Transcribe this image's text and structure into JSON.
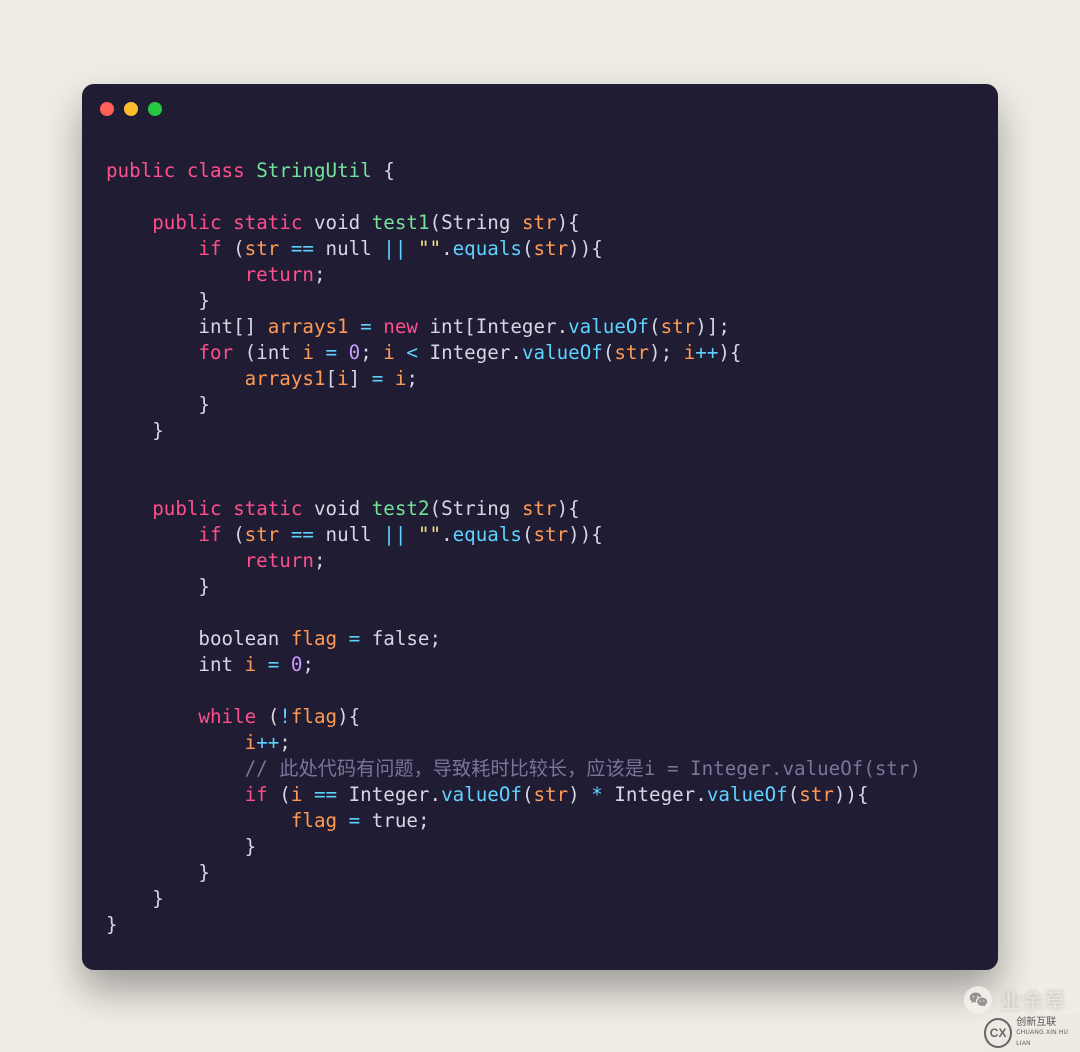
{
  "window": {
    "dot_colors": [
      "#ff5f57",
      "#febc2e",
      "#28c840"
    ]
  },
  "code": {
    "class_decl": {
      "kw_public": "public",
      "kw_class": "class",
      "name": "StringUtil",
      "brace_open": " {"
    },
    "m1": {
      "kw_public": "public",
      "kw_static": "static",
      "ret": "void",
      "name": "test1",
      "param_type": "String",
      "param_name": "str",
      "tail": "){",
      "if_kw": "if",
      "if_open": " (",
      "var_str": "str",
      "op_eq": " == ",
      "null_lit": "null",
      "op_or": " || ",
      "str_lit": "\"\"",
      "dot": ".",
      "equals_call": "equals",
      "p_open": "(",
      "arg_str": "str",
      "p_close_brace": ")){",
      "return_kw": "return",
      "semi": ";",
      "brace_close": "}",
      "intarr": "int[] ",
      "arrays1": "arrays1",
      "op_assign": " = ",
      "new_kw": "new",
      "int_bracket_open": " int[",
      "Integer": "Integer",
      "dot2": ".",
      "valueOf": "valueOf",
      "p_open2": "(",
      "arg_str2": "str",
      "p_close2_bracket_semi": ")];",
      "for_kw": "for",
      "for_open": " (",
      "for_int": "int ",
      "i": "i",
      "assign0": " = ",
      "zero": "0",
      "semi1": "; ",
      "i2": "i",
      "lt": " < ",
      "Integer2": "Integer",
      "dot3": ".",
      "valueOf2": "valueOf",
      "p_open3": "(",
      "arg_str3": "str",
      "p_close3_semi": "); ",
      "i3": "i",
      "pp": "++",
      "for_tail": "){",
      "arr_idx_open": "arrays1",
      "idx_open": "[",
      "i4": "i",
      "idx_close": "] ",
      "assign_i": "= ",
      "i5": "i",
      "semi2": ";",
      "brace_close2": "}",
      "brace_close3": "}"
    },
    "m2": {
      "kw_public": "public",
      "kw_static": "static",
      "ret": "void",
      "name": "test2",
      "param_type": "String",
      "param_name": "str",
      "tail": "){",
      "if_kw": "if",
      "if_open": " (",
      "var_str": "str",
      "op_eq": " == ",
      "null_lit": "null",
      "op_or": " || ",
      "str_lit": "\"\"",
      "dot": ".",
      "equals_call": "equals",
      "p_open": "(",
      "arg_str": "str",
      "p_close_brace": ")){",
      "return_kw": "return",
      "semi": ";",
      "brace_close": "}",
      "bool": "boolean ",
      "flag": "flag",
      "assign1": " = ",
      "false_lit": "false",
      "semi1": ";",
      "int_decl": "int ",
      "i": "i",
      "assign2": " = ",
      "zero": "0",
      "semi2": ";",
      "while_kw": "while",
      "while_open": " (",
      "bang": "!",
      "flag2": "flag",
      "while_tail": "){",
      "i2": "i",
      "pp": "++",
      "semi3": ";",
      "comment": "// 此处代码有问题，导致耗时比较长，应该是i = Integer.valueOf(str)",
      "if2_kw": "if",
      "if2_open": " (",
      "i3": "i",
      "eq2": " == ",
      "Integer1": "Integer",
      "dot1": ".",
      "valueOf1": "valueOf",
      "p_open1": "(",
      "arg_str1": "str",
      "p_close1": ") ",
      "star": "* ",
      "Integer2": "Integer",
      "dot2": ".",
      "valueOf2": "valueOf",
      "p_open2": "(",
      "arg_str2": "str",
      "p_close2_brace": ")){",
      "flag3": "flag",
      "assign3": " = ",
      "true_lit": "true",
      "semi4": ";",
      "brace_close2": "}",
      "brace_close3": "}",
      "brace_close4": "}"
    },
    "final_brace": "}"
  },
  "watermark": {
    "text": "业余草"
  },
  "corner": {
    "badge": "CX",
    "line1": "创新互联",
    "line2": "CHUANG XIN HU LIAN"
  }
}
